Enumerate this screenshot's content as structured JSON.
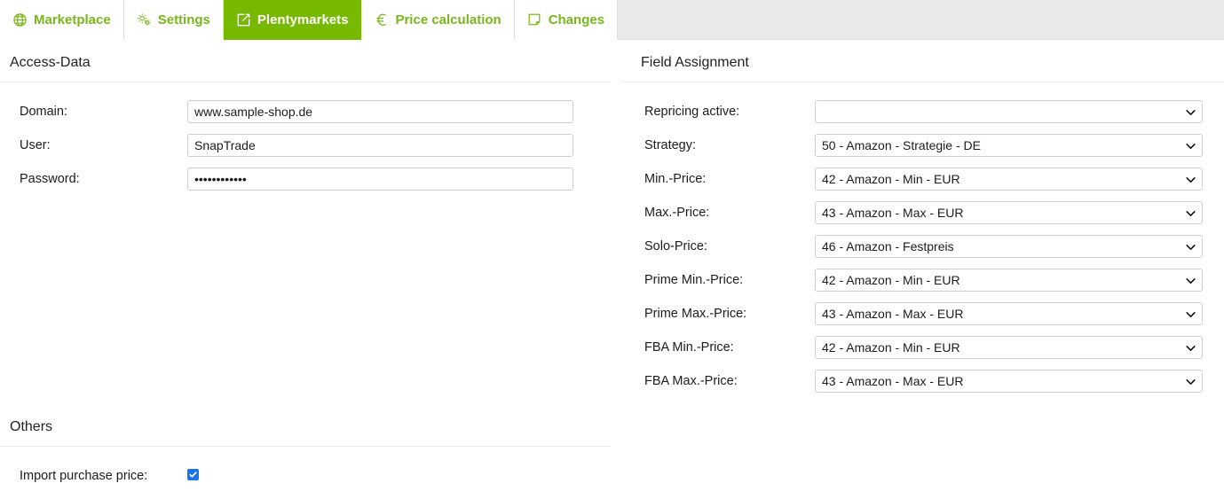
{
  "tabs": [
    {
      "label": "Marketplace",
      "icon": "globe-icon",
      "active": false
    },
    {
      "label": "Settings",
      "icon": "gears-icon",
      "active": false
    },
    {
      "label": "Plentymarkets",
      "icon": "external-link-icon",
      "active": true
    },
    {
      "label": "Price calculation",
      "icon": "euro-icon",
      "active": false
    },
    {
      "label": "Changes",
      "icon": "note-page-icon",
      "active": false
    }
  ],
  "colors": {
    "brand_green": "#76b900",
    "tab_text_green": "#79b51c",
    "tabbar_background": "#e9e9e9",
    "checkbox_blue": "#1a73e8",
    "border_gray": "#cfcfcf"
  },
  "access_data": {
    "title": "Access-Data",
    "fields": [
      {
        "label": "Domain:",
        "value": "www.sample-shop.de",
        "placeholder": "",
        "type": "text"
      },
      {
        "label": "User:",
        "value": "SnapTrade",
        "placeholder": "",
        "type": "text"
      },
      {
        "label": "Password:",
        "value": "••••••••••••",
        "placeholder": "",
        "type": "password"
      }
    ]
  },
  "others": {
    "title": "Others",
    "import_purchase_price_label": "Import purchase price:",
    "import_purchase_price_checked": true
  },
  "field_assignment": {
    "title": "Field Assignment",
    "rows": [
      {
        "label": "Repricing active:",
        "value": ""
      },
      {
        "label": "Strategy:",
        "value": "50 - Amazon - Strategie - DE"
      },
      {
        "label": "Min.-Price:",
        "value": "42 - Amazon - Min - EUR"
      },
      {
        "label": "Max.-Price:",
        "value": "43 - Amazon - Max - EUR"
      },
      {
        "label": "Solo-Price:",
        "value": "46 - Amazon - Festpreis"
      },
      {
        "label": "Prime Min.-Price:",
        "value": "42 - Amazon - Min - EUR"
      },
      {
        "label": "Prime Max.-Price:",
        "value": "43 - Amazon - Max - EUR"
      },
      {
        "label": "FBA Min.-Price:",
        "value": "42 - Amazon - Min - EUR"
      },
      {
        "label": "FBA Max.-Price:",
        "value": "43 - Amazon - Max - EUR"
      }
    ]
  }
}
